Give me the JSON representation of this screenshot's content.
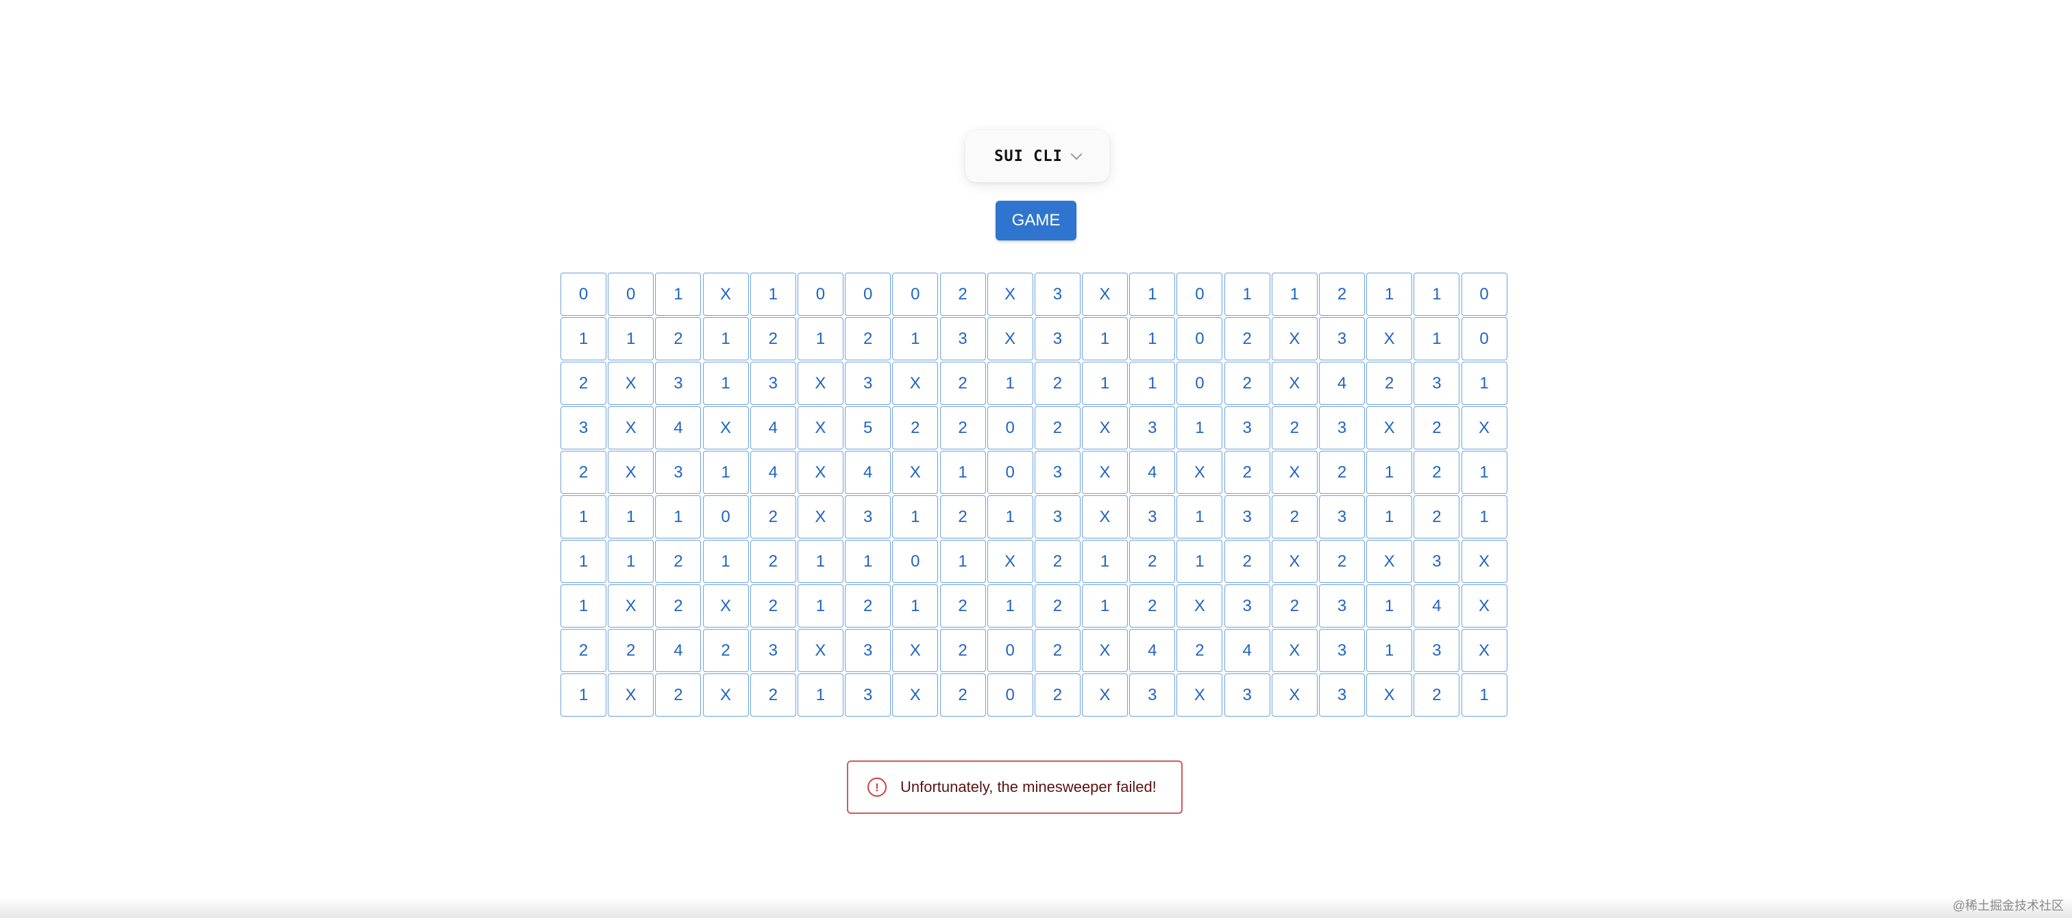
{
  "wallet": {
    "label": "SUI CLI",
    "icon": "chevron-down-icon"
  },
  "game_button": {
    "label": "GAME",
    "color": "#2f75cf"
  },
  "board": {
    "columns": 20,
    "rows_count": 10,
    "mine_symbol": "X",
    "cell_border_color": "#6aa2dd",
    "cell_text_color": "#1f64c1",
    "rows": [
      [
        "0",
        "0",
        "1",
        "X",
        "1",
        "0",
        "0",
        "0",
        "2",
        "X",
        "3",
        "X",
        "1",
        "0",
        "1",
        "1",
        "2",
        "1",
        "1",
        "0"
      ],
      [
        "1",
        "1",
        "2",
        "1",
        "2",
        "1",
        "2",
        "1",
        "3",
        "X",
        "3",
        "1",
        "1",
        "0",
        "2",
        "X",
        "3",
        "X",
        "1",
        "0"
      ],
      [
        "2",
        "X",
        "3",
        "1",
        "3",
        "X",
        "3",
        "X",
        "2",
        "1",
        "2",
        "1",
        "1",
        "0",
        "2",
        "X",
        "4",
        "2",
        "3",
        "1"
      ],
      [
        "3",
        "X",
        "4",
        "X",
        "4",
        "X",
        "5",
        "2",
        "2",
        "0",
        "2",
        "X",
        "3",
        "1",
        "3",
        "2",
        "3",
        "X",
        "2",
        "X"
      ],
      [
        "2",
        "X",
        "3",
        "1",
        "4",
        "X",
        "4",
        "X",
        "1",
        "0",
        "3",
        "X",
        "4",
        "X",
        "2",
        "X",
        "2",
        "1",
        "2",
        "1"
      ],
      [
        "1",
        "1",
        "1",
        "0",
        "2",
        "X",
        "3",
        "1",
        "2",
        "1",
        "3",
        "X",
        "3",
        "1",
        "3",
        "2",
        "3",
        "1",
        "2",
        "1"
      ],
      [
        "1",
        "1",
        "2",
        "1",
        "2",
        "1",
        "1",
        "0",
        "1",
        "X",
        "2",
        "1",
        "2",
        "1",
        "2",
        "X",
        "2",
        "X",
        "3",
        "X"
      ],
      [
        "1",
        "X",
        "2",
        "X",
        "2",
        "1",
        "2",
        "1",
        "2",
        "1",
        "2",
        "1",
        "2",
        "X",
        "3",
        "2",
        "3",
        "1",
        "4",
        "X"
      ],
      [
        "2",
        "2",
        "4",
        "2",
        "3",
        "X",
        "3",
        "X",
        "2",
        "0",
        "2",
        "X",
        "4",
        "2",
        "4",
        "X",
        "3",
        "1",
        "3",
        "X"
      ],
      [
        "1",
        "X",
        "2",
        "X",
        "2",
        "1",
        "3",
        "X",
        "2",
        "0",
        "2",
        "X",
        "3",
        "X",
        "3",
        "X",
        "3",
        "X",
        "2",
        "1"
      ]
    ]
  },
  "alert": {
    "icon": "error-circle-icon",
    "icon_glyph": "!",
    "message": "Unfortunately, the minesweeper failed!",
    "border_color": "#cf5b5b"
  },
  "watermark": {
    "text": "@稀土掘金技术社区"
  }
}
